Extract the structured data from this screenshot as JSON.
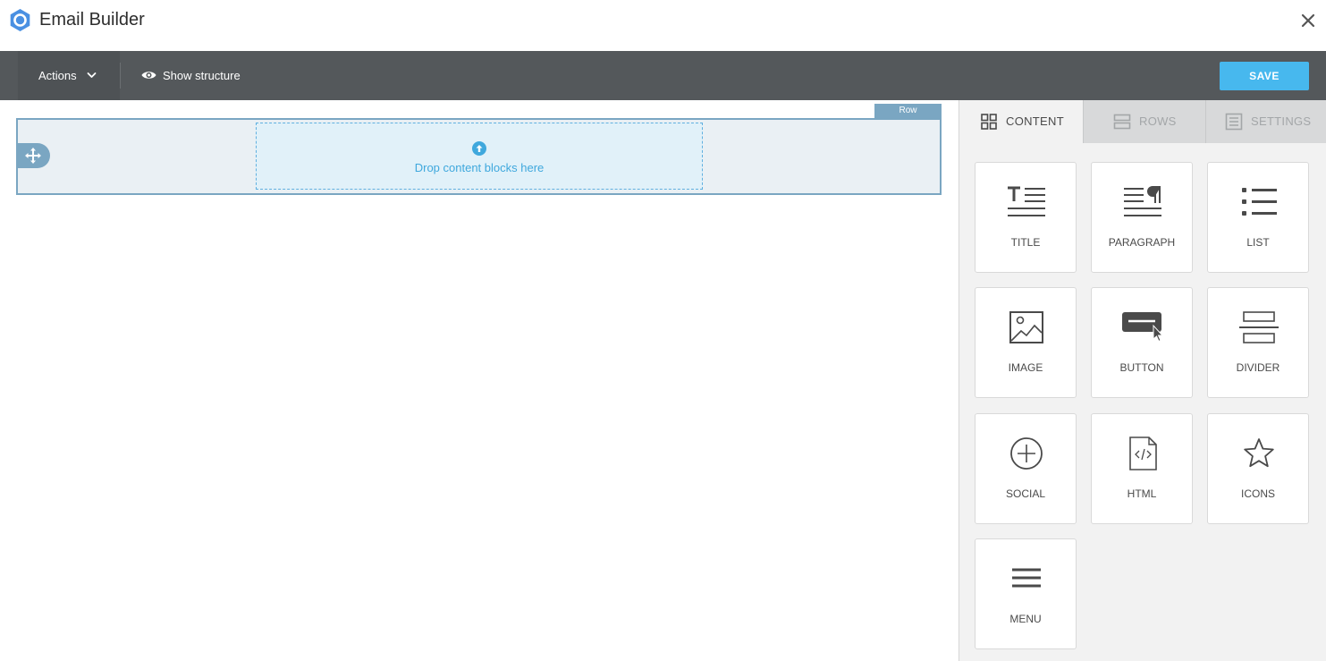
{
  "window": {
    "title": "Email Builder"
  },
  "toolbar": {
    "actions_label": "Actions",
    "show_structure_label": "Show structure",
    "save_label": "SAVE"
  },
  "canvas": {
    "row_tag": "Row",
    "drop_text": "Drop content blocks here"
  },
  "sidebar": {
    "tabs": [
      {
        "label": "CONTENT",
        "icon": "grid-icon",
        "active": true
      },
      {
        "label": "ROWS",
        "icon": "rows-icon",
        "active": false
      },
      {
        "label": "SETTINGS",
        "icon": "settings-icon",
        "active": false
      }
    ],
    "blocks": [
      {
        "label": "TITLE",
        "icon": "title-icon"
      },
      {
        "label": "PARAGRAPH",
        "icon": "paragraph-icon"
      },
      {
        "label": "LIST",
        "icon": "list-icon"
      },
      {
        "label": "IMAGE",
        "icon": "image-icon"
      },
      {
        "label": "BUTTON",
        "icon": "button-icon"
      },
      {
        "label": "DIVIDER",
        "icon": "divider-icon"
      },
      {
        "label": "SOCIAL",
        "icon": "social-icon"
      },
      {
        "label": "HTML",
        "icon": "html-icon"
      },
      {
        "label": "ICONS",
        "icon": "star-icon"
      },
      {
        "label": "MENU",
        "icon": "menu-icon"
      }
    ]
  },
  "colors": {
    "toolbar": "#54585b",
    "accent": "#47b8ee",
    "row_border": "#7aa6c2",
    "logo": "#4a90e2"
  }
}
